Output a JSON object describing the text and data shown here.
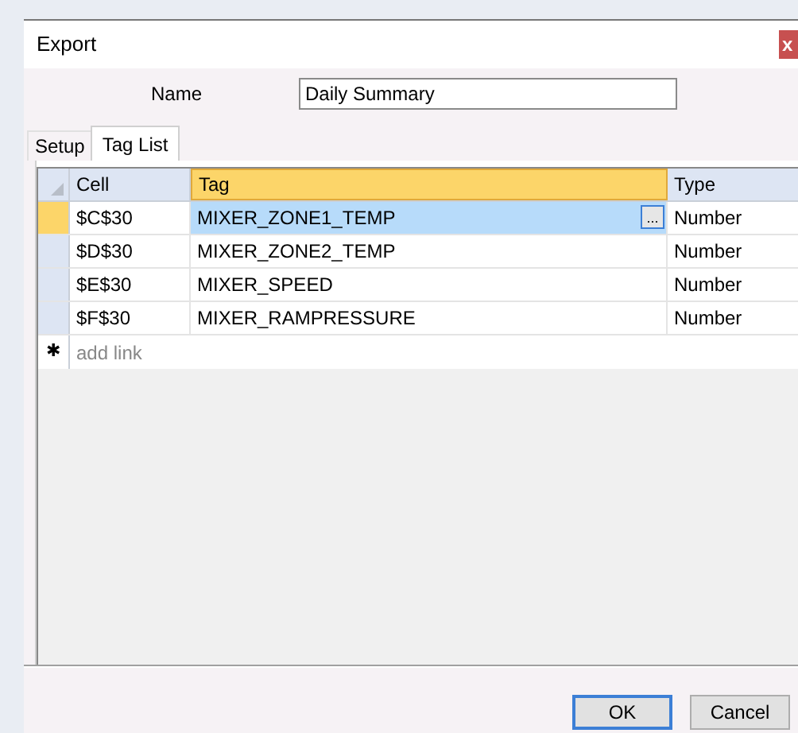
{
  "window": {
    "title": "Export",
    "close": "x"
  },
  "name_field": {
    "label": "Name",
    "value": "Daily Summary"
  },
  "tabs": [
    {
      "label": "Setup",
      "selected": false
    },
    {
      "label": "Tag List",
      "selected": true
    }
  ],
  "table": {
    "columns": [
      "Cell",
      "Tag",
      "Type"
    ],
    "rows": [
      {
        "cell": "$C$30",
        "tag": "MIXER_ZONE1_TEMP",
        "type": "Number",
        "selected": true,
        "browse": "..."
      },
      {
        "cell": "$D$30",
        "tag": "MIXER_ZONE2_TEMP",
        "type": "Number",
        "selected": false
      },
      {
        "cell": "$E$30",
        "tag": "MIXER_SPEED",
        "type": "Number",
        "selected": false
      },
      {
        "cell": "$F$30",
        "tag": "MIXER_RAMPRESSURE",
        "type": "Number",
        "selected": false
      }
    ],
    "new_row": {
      "marker": "✱",
      "placeholder": "add link"
    }
  },
  "buttons": [
    {
      "label": "OK",
      "selected": true
    },
    {
      "label": "Cancel",
      "selected": false
    }
  ]
}
